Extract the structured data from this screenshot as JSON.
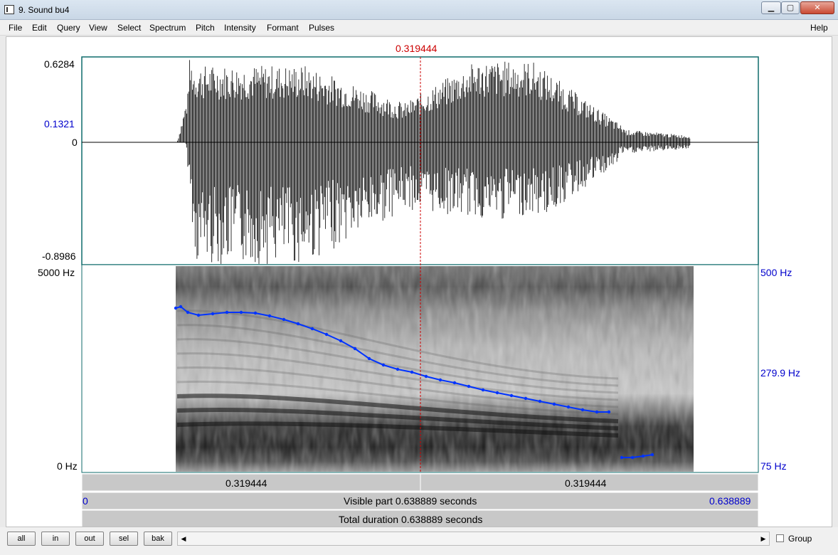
{
  "window": {
    "title": "9. Sound bu4"
  },
  "menu": {
    "items": [
      "File",
      "Edit",
      "Query",
      "View",
      "Select",
      "Spectrum",
      "Pitch",
      "Intensity",
      "Formant",
      "Pulses"
    ],
    "help": "Help"
  },
  "cursor": {
    "time_label": "0.319444"
  },
  "waveform": {
    "ymax": "0.6284",
    "ymid": "0.1321",
    "yzero": "0",
    "ymin": "-0.8986"
  },
  "spectrogram": {
    "freq_top": "5000 Hz",
    "freq_bottom": "0 Hz"
  },
  "pitch": {
    "top": "500 Hz",
    "mid": "279.9 Hz",
    "bottom": "75 Hz"
  },
  "time_bars": {
    "left_segment": "0.319444",
    "right_segment": "0.319444",
    "visible_start": "0",
    "visible_label": "Visible part 0.638889 seconds",
    "visible_end": "0.638889",
    "total_label": "Total duration 0.638889 seconds"
  },
  "buttons": {
    "all": "all",
    "in": "in",
    "out": "out",
    "sel": "sel",
    "bak": "bak"
  },
  "group": {
    "label": "Group"
  },
  "colors": {
    "pitch_line": "#0033ff",
    "cursor": "#cc0000",
    "labels_blue": "#0000cc"
  }
}
